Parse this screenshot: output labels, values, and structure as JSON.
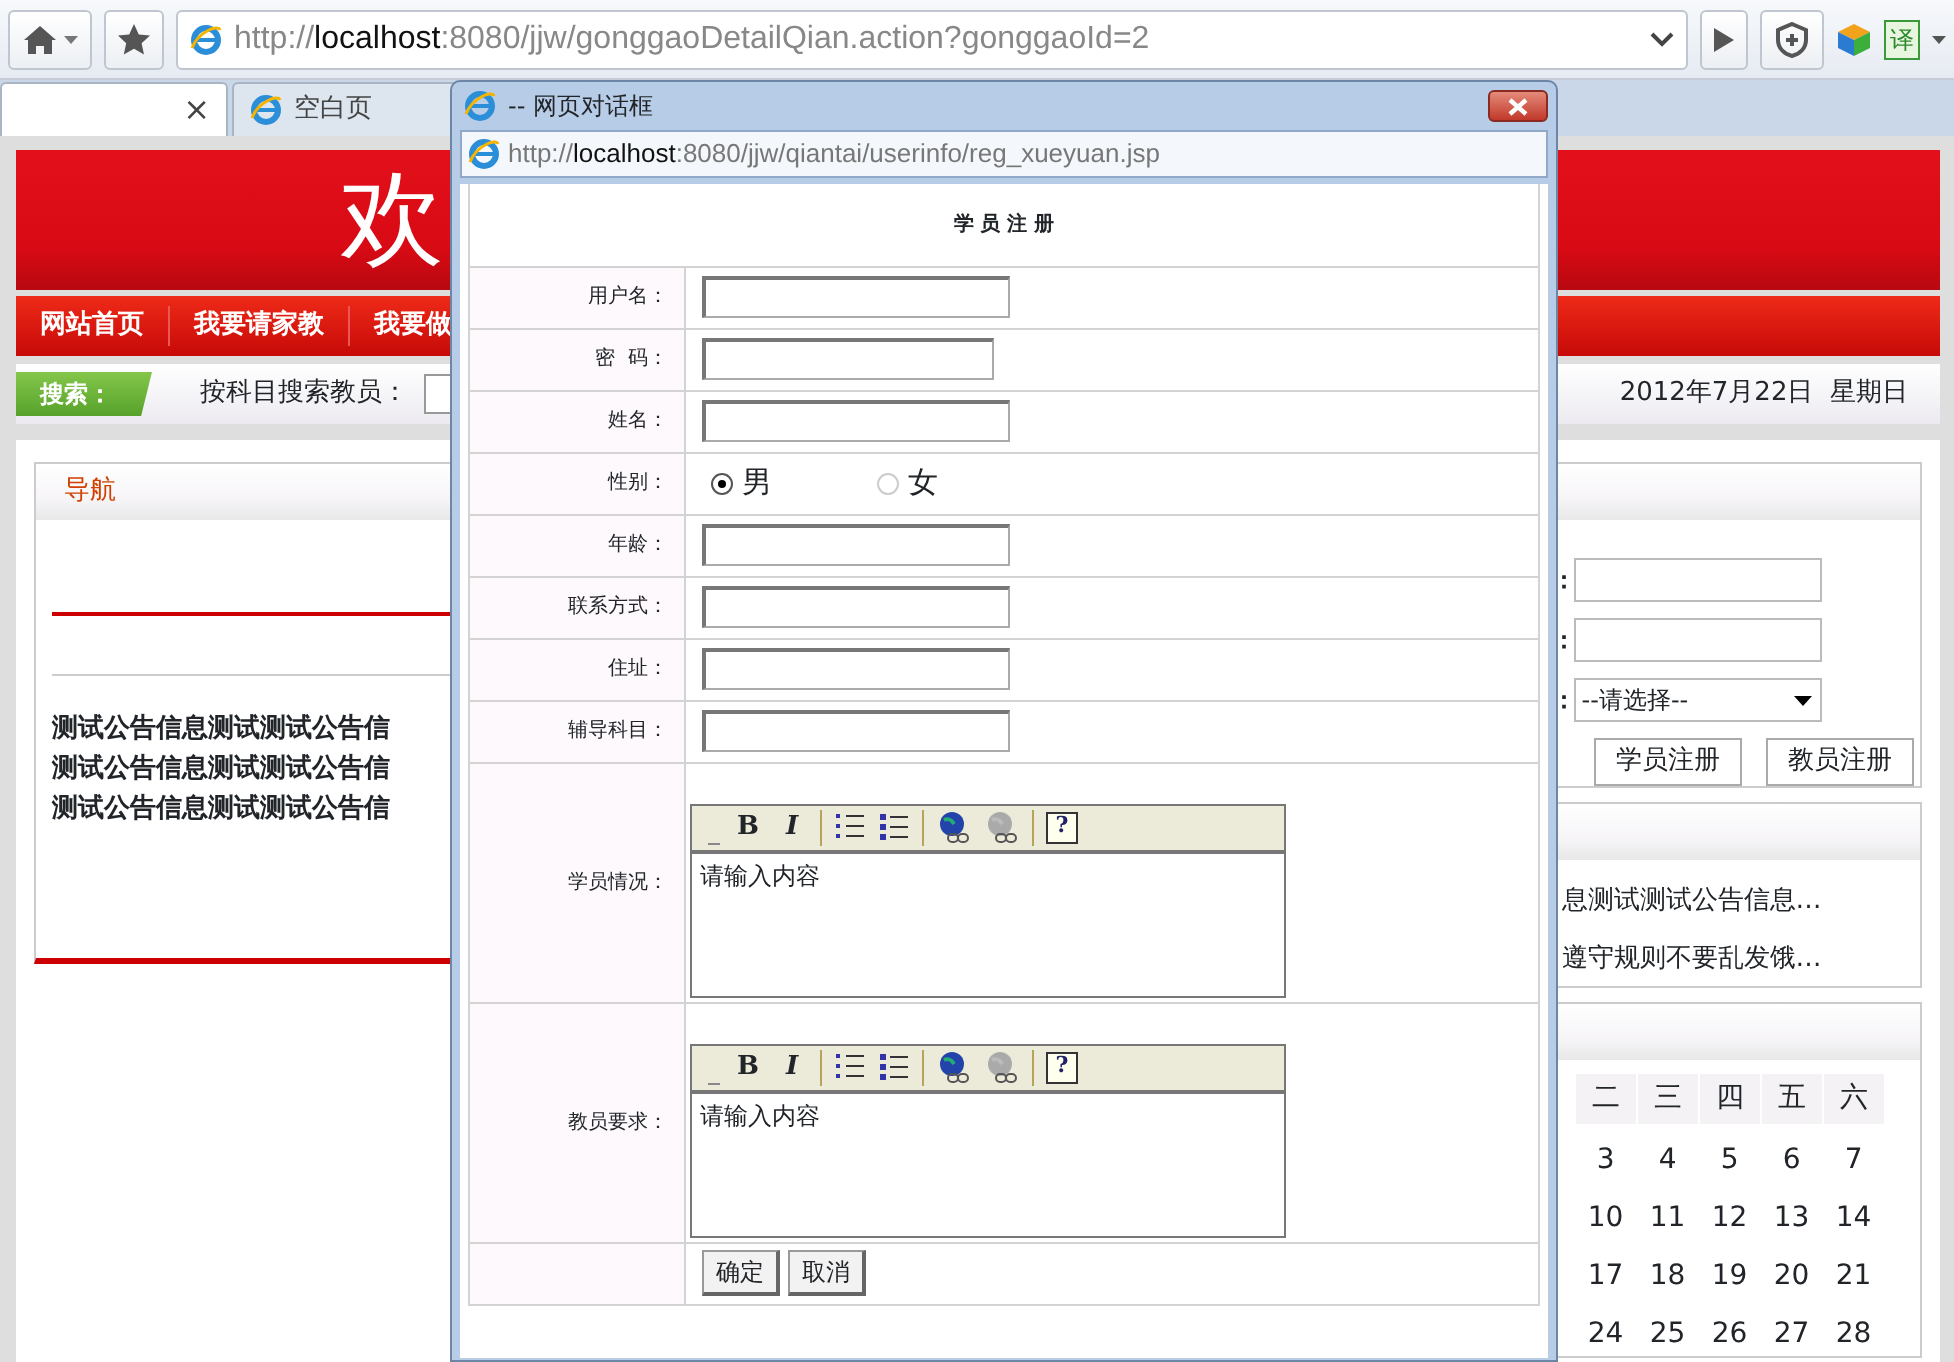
{
  "browser": {
    "url_host": "localhost",
    "url_scheme": "http://",
    "url_rest": ":8080/jjw/gonggaoDetailQian.action?gonggaoId=2",
    "translate_label": "译",
    "tabs": [
      {
        "selected": true,
        "close": "×"
      },
      {
        "label": "空白页",
        "selected": false
      }
    ]
  },
  "page": {
    "banner_text": "欢",
    "nav": [
      "网站首页",
      "我要请家教",
      "我要做"
    ],
    "search": {
      "tag": "搜索：",
      "label": "按科目搜索教员："
    },
    "date": "2012年7月22日  星期日",
    "nav_panel": {
      "title": "导航",
      "lines": [
        "测试公告信息测试测试公告信",
        "测试公告信息测试测试公告信",
        "测试公告信息测试测试公告信"
      ]
    },
    "login_panel": {
      "fields": [
        {
          "label": "：",
          "kind": "text"
        },
        {
          "label": "：",
          "kind": "text"
        },
        {
          "label": "：",
          "kind": "select",
          "value": "--请选择--"
        }
      ],
      "buttons": [
        "学员注册",
        "教员注册"
      ]
    },
    "notices": [
      "息测试测试公告信息…",
      "遵守规则不要乱发饿…"
    ],
    "calendar": {
      "weekdays": [
        "二",
        "三",
        "四",
        "五",
        "六"
      ],
      "weeks": [
        [
          "3",
          "4",
          "5",
          "6",
          "7"
        ],
        [
          "10",
          "11",
          "12",
          "13",
          "14"
        ],
        [
          "17",
          "18",
          "19",
          "20",
          "21"
        ],
        [
          "24",
          "25",
          "26",
          "27",
          "28"
        ]
      ]
    }
  },
  "dialog": {
    "title": "-- 网页对话框",
    "url_scheme": "http://",
    "url_host": "localhost",
    "url_rest": ":8080/jjw/qiantai/userinfo/reg_xueyuan.jsp",
    "heading": "学 员 注 册",
    "rows": [
      {
        "label": "用户名：",
        "kind": "text"
      },
      {
        "label": "密  码：",
        "kind": "password"
      },
      {
        "label": "姓名：",
        "kind": "text"
      },
      {
        "label": "性别：",
        "kind": "radio",
        "options": [
          {
            "label": "男",
            "selected": true
          },
          {
            "label": "女",
            "selected": false
          }
        ]
      },
      {
        "label": "年龄：",
        "kind": "text"
      },
      {
        "label": "联系方式：",
        "kind": "text"
      },
      {
        "label": "住址：",
        "kind": "text"
      },
      {
        "label": "辅导科目：",
        "kind": "text"
      },
      {
        "label": "学员情况：",
        "kind": "editor",
        "content": "请输入内容",
        "toolbar": [
          {
            "kind": "bold",
            "label": "B"
          },
          {
            "kind": "italic",
            "label": "I"
          },
          {
            "kind": "ordered"
          },
          {
            "kind": "bullets"
          },
          {
            "kind": "link",
            "disabled": false
          },
          {
            "kind": "link",
            "disabled": true
          },
          {
            "kind": "help",
            "label": "?"
          }
        ]
      },
      {
        "label": "教员要求：",
        "kind": "editor",
        "content": "请输入内容",
        "toolbar": [
          {
            "kind": "bold",
            "label": "B"
          },
          {
            "kind": "italic",
            "label": "I"
          },
          {
            "kind": "ordered"
          },
          {
            "kind": "bullets"
          },
          {
            "kind": "link",
            "disabled": false
          },
          {
            "kind": "link",
            "disabled": true
          },
          {
            "kind": "help",
            "label": "?"
          }
        ]
      }
    ],
    "buttons": [
      "确定",
      "取消"
    ]
  }
}
